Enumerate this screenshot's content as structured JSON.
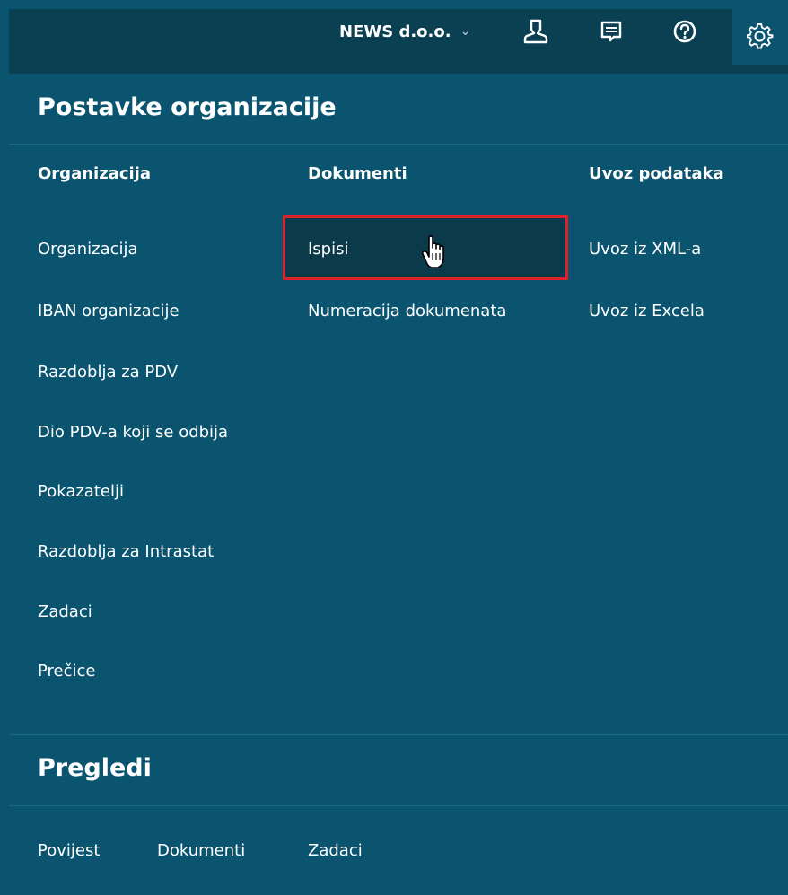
{
  "topbar": {
    "org_name": "NEWS d.o.o.",
    "icons": [
      "user-icon",
      "chat-icon",
      "help-icon",
      "gear-icon"
    ]
  },
  "settings": {
    "title": "Postavke organizacije",
    "columns": [
      {
        "heading": "Organizacija",
        "items": [
          "Organizacija",
          "IBAN organizacije",
          "Razdoblja za PDV",
          "Dio PDV-a koji se odbija",
          "Pokazatelji",
          "Razdoblja za Intrastat",
          "Zadaci",
          "Prečice"
        ]
      },
      {
        "heading": "Dokumenti",
        "items": [
          "Ispisi",
          "Numeracija dokumenata"
        ]
      },
      {
        "heading": "Uvoz podataka",
        "items": [
          "Uvoz iz XML-a",
          "Uvoz iz Excela"
        ]
      }
    ]
  },
  "pregledi": {
    "title": "Pregledi",
    "items": [
      "Povijest",
      "Dokumenti",
      "Zadaci"
    ]
  },
  "colors": {
    "panel_bg": "#0a5470",
    "topbar_bg": "#0b3f52",
    "highlight_border": "#e0202a",
    "highlight_bg": "#0b3a4b"
  }
}
